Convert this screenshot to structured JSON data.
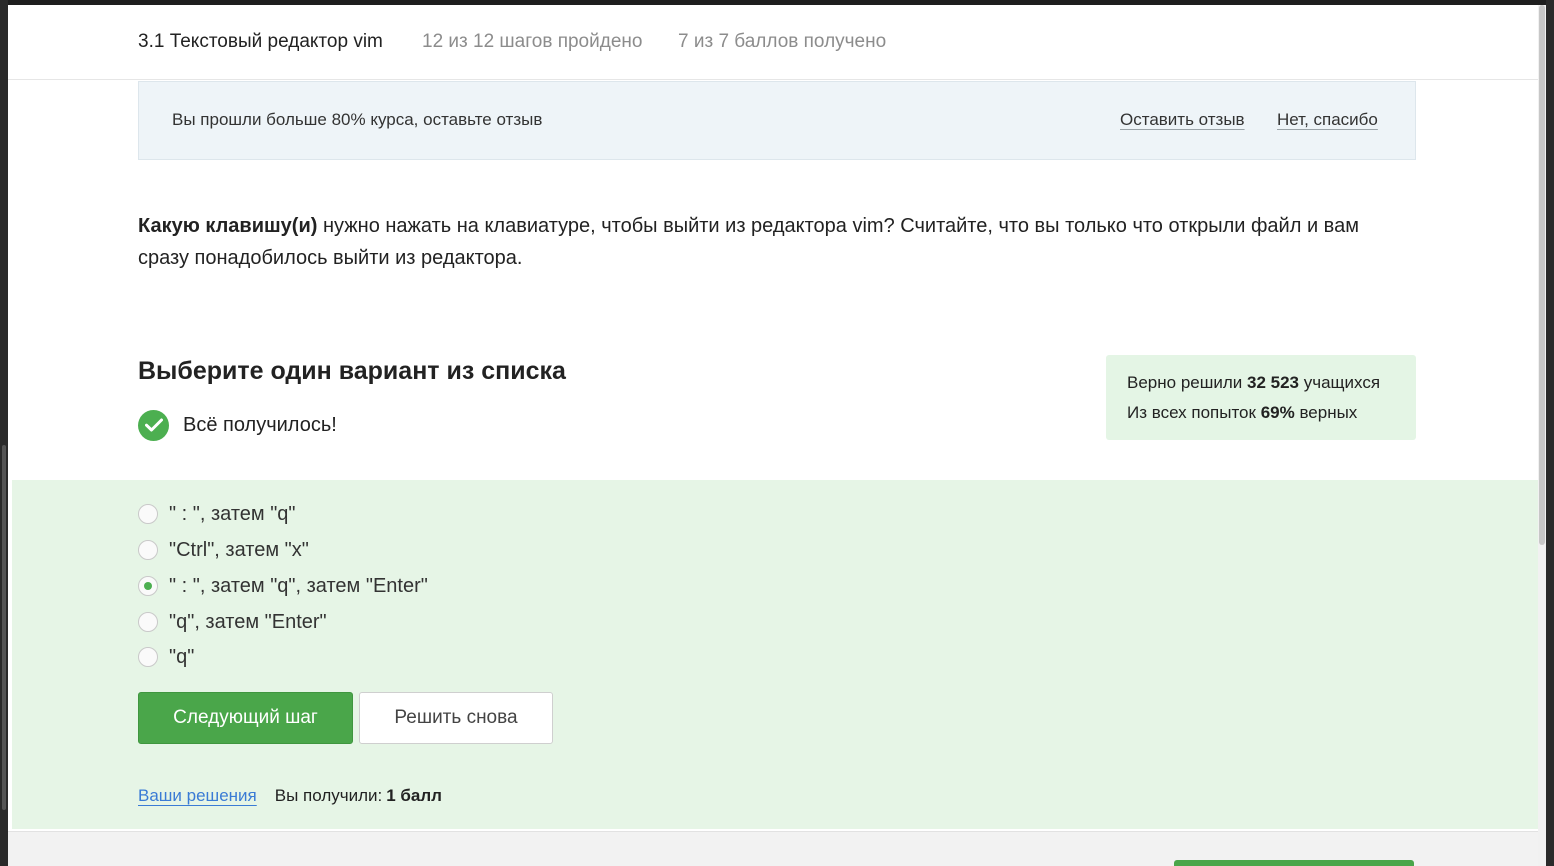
{
  "header": {
    "lesson_title": "3.1 Текстовый редактор vim",
    "steps_progress": "12 из 12 шагов пройдено",
    "points_progress": "7 из 7 баллов  получено"
  },
  "review_banner": {
    "message": "Вы прошли больше 80% курса, оставьте отзыв",
    "leave_review": "Оставить отзыв",
    "no_thanks": "Нет, спасибо"
  },
  "question": {
    "bold_part": "Какую клавишу(и)",
    "rest": " нужно нажать на клавиатуре, чтобы выйти из редактора vim? Считайте, что вы только что открыли файл и вам сразу понадобилось выйти из редактора."
  },
  "quiz": {
    "title": "Выберите один вариант из списка",
    "success_message": "Всё получилось!"
  },
  "stats": {
    "solved_prefix": "Верно решили ",
    "solved_count": "32 523",
    "solved_suffix": " учащихся",
    "attempts_prefix": "Из всех попыток ",
    "attempts_percent": "69%",
    "attempts_suffix": " верных"
  },
  "options": [
    {
      "label": "\" : \", затем \"q\"",
      "selected": false
    },
    {
      "label": "\"Ctrl\", затем \"x\"",
      "selected": false
    },
    {
      "label": "\" : \", затем \"q\", затем \"Enter\"",
      "selected": true
    },
    {
      "label": "\"q\", затем \"Enter\"",
      "selected": false
    },
    {
      "label": "\"q\"",
      "selected": false
    }
  ],
  "buttons": {
    "next_step": "Следующий шаг",
    "solve_again": "Решить снова"
  },
  "footer": {
    "your_solutions": "Ваши решения",
    "you_got": "Вы получили:",
    "score": "1 балл"
  },
  "colors": {
    "accent_green": "#4aa64a",
    "answer_bg": "#e6f5e6",
    "link_blue": "#3a7bd5"
  }
}
